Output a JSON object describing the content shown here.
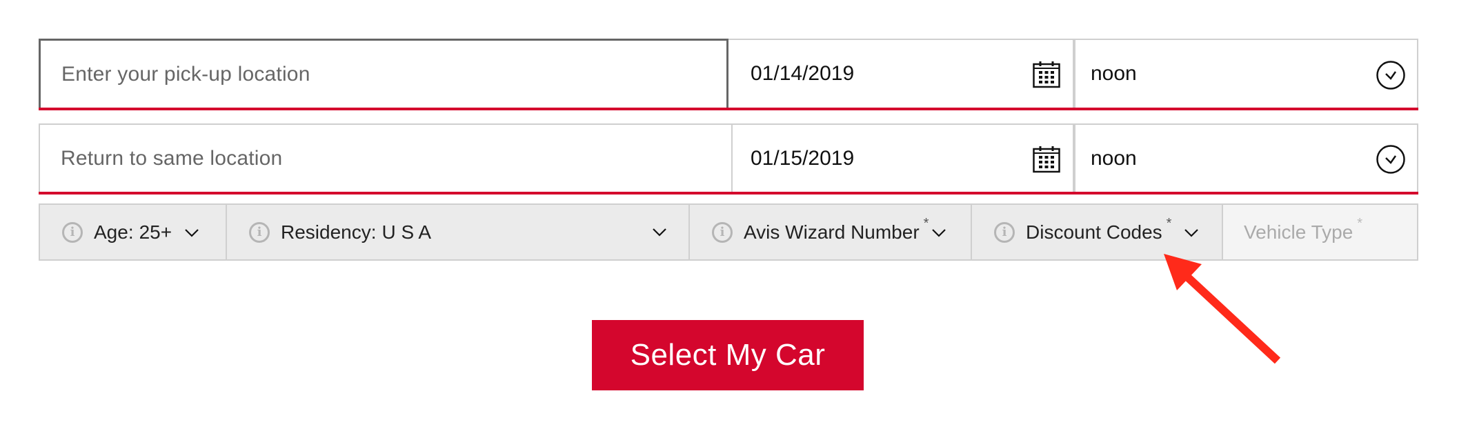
{
  "pickup": {
    "location_placeholder": "Enter your pick-up location",
    "date": "01/14/2019",
    "time": "noon"
  },
  "return": {
    "location_placeholder": "Return to same location",
    "date": "01/15/2019",
    "time": "noon"
  },
  "options": {
    "age": {
      "label": "Age:",
      "value": "25+"
    },
    "residency": {
      "label": "Residency:",
      "value": "U S A"
    },
    "wizard": {
      "label": "Avis Wizard Number",
      "required_mark": "*"
    },
    "discount": {
      "label": "Discount Codes",
      "required_mark": "*"
    },
    "vehicle": {
      "label": "Vehicle Type",
      "required_mark": "*"
    }
  },
  "info_glyph": "i",
  "submit_label": "Select My Car",
  "colors": {
    "accent": "#d4062d",
    "annotation_arrow": "#ff2a1a"
  },
  "annotation": {
    "type": "arrow",
    "points_to": "discount-codes-dropdown"
  }
}
